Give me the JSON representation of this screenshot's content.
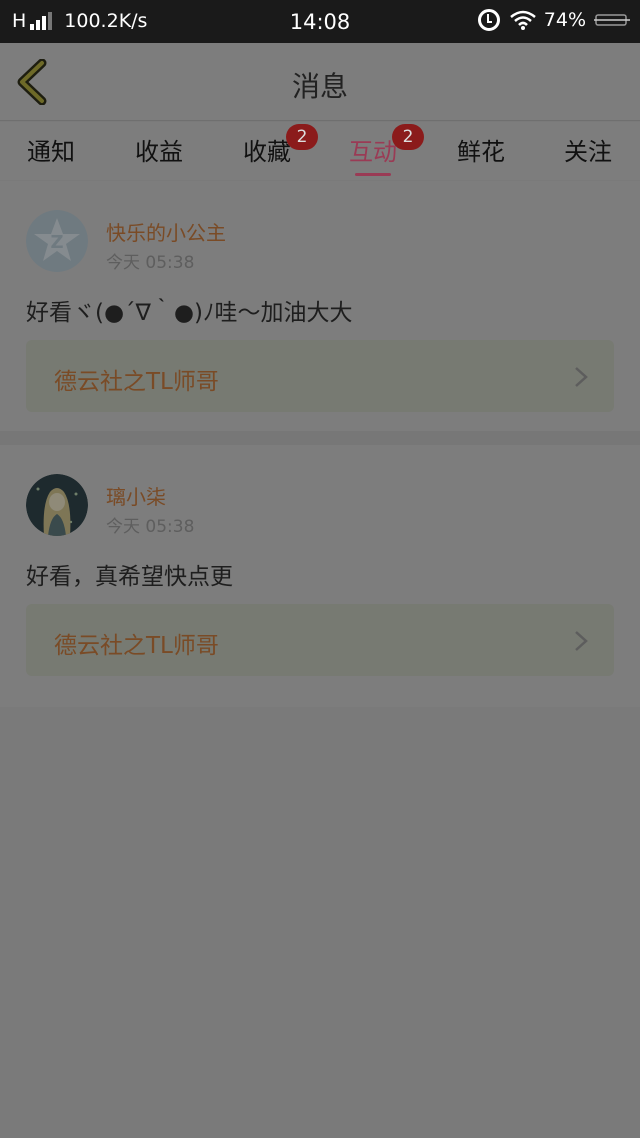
{
  "status_bar": {
    "network": "H",
    "speed": "100.2K/s",
    "time": "14:08",
    "battery": "74%",
    "charging_indicator": "no-charge-icon"
  },
  "header": {
    "title": "消息",
    "back_icon": "chevron-left-icon"
  },
  "tabs": [
    {
      "label": "通知",
      "badge": ""
    },
    {
      "label": "收益",
      "badge": ""
    },
    {
      "label": "收藏",
      "badge": "2"
    },
    {
      "label": "互动",
      "badge": "2",
      "active": true
    },
    {
      "label": "鲜花",
      "badge": ""
    },
    {
      "label": "关注",
      "badge": ""
    }
  ],
  "messages": [
    {
      "user": "快乐的小公主",
      "time": "今天 05:38",
      "comment": "好看ヾ(●´∇｀●)ﾉ哇～加油大大",
      "book": "德云社之TL师哥",
      "avatar": "qq-default-avatar"
    },
    {
      "user": "璃小柒",
      "time": "今天 05:38",
      "comment": "好看，真希望快点更",
      "book": "德云社之TL师哥",
      "avatar": "anime-girl-avatar"
    }
  ],
  "colors": {
    "accent": "#9a3b55",
    "badge": "#8b1b1b",
    "username": "#7a4b26"
  }
}
